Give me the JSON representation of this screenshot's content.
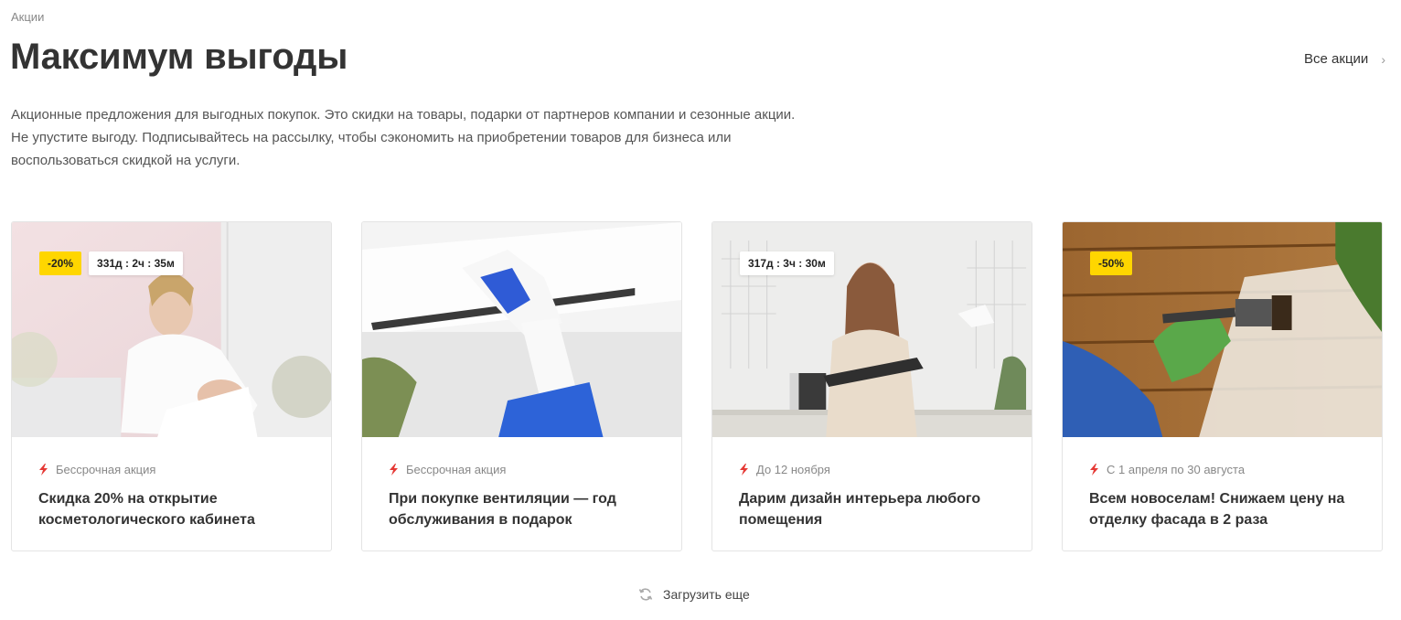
{
  "breadcrumb": "Акции",
  "title": "Максимум выгоды",
  "all_link": {
    "label": "Все акции",
    "icon": "chevron-right-icon"
  },
  "intro": {
    "line1": "Акционные предложения для выгодных покупок. Это скидки на товары, подарки от партнеров компании и сезонные акции.",
    "line2": "Не упустите выгоду. Подписывайтесь на рассылку, чтобы сэкономить на приобретении товаров для бизнеса или",
    "line3": "воспользоваться скидкой на услуги."
  },
  "colors": {
    "badge": "#ffd600",
    "accent": "#e53935",
    "text": "#333333",
    "muted": "#888888"
  },
  "cards": [
    {
      "discount": "-20%",
      "timer": "331д : 2ч : 35м",
      "date": "Бессрочная акция",
      "title_line1": "Скидка 20% на открытие",
      "title_line2": "косметологического кабинета",
      "image": "cosmetologist-photo"
    },
    {
      "discount": "",
      "timer": "",
      "date": "Бессрочная акция",
      "title_line1": "При покупке вентиляции — год",
      "title_line2": "обслуживания в подарок",
      "image": "air-conditioner-cleaning-photo"
    },
    {
      "discount": "",
      "timer": "317д : 3ч : 30м",
      "date": "До 12 ноября",
      "title_line1": "Дарим дизайн интерьера любого",
      "title_line2": "помещения",
      "image": "interior-designer-photo"
    },
    {
      "discount": "-50%",
      "timer": "",
      "date": "С 1 апреля по 30 августа",
      "title_line1": "Всем новоселам! Снижаем цену на",
      "title_line2": "отделку фасада в 2 раза",
      "image": "facade-painting-photo"
    }
  ],
  "load_more": {
    "label": "Загрузить еще",
    "icon": "refresh-icon"
  }
}
